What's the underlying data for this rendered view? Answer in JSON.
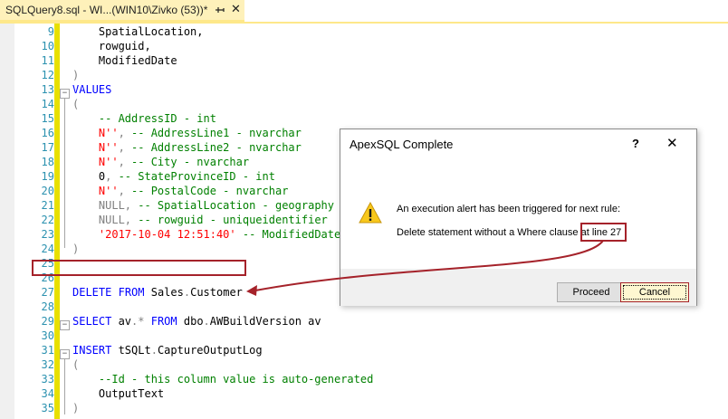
{
  "tab": {
    "title": "SQLQuery8.sql - WI...(WIN10\\Zivko (53))*",
    "close": "✕"
  },
  "editor": {
    "lines": [
      {
        "num": "9",
        "segments": [
          {
            "t": "    SpatialLocation,",
            "c": ""
          }
        ]
      },
      {
        "num": "10",
        "segments": [
          {
            "t": "    rowguid,",
            "c": ""
          }
        ]
      },
      {
        "num": "11",
        "segments": [
          {
            "t": "    ModifiedDate",
            "c": ""
          }
        ]
      },
      {
        "num": "12",
        "segments": [
          {
            "t": ")",
            "c": "gr"
          }
        ]
      },
      {
        "num": "13",
        "segments": [
          {
            "t": "VALUES",
            "c": "kw"
          }
        ]
      },
      {
        "num": "14",
        "segments": [
          {
            "t": "(",
            "c": "gr"
          }
        ]
      },
      {
        "num": "15",
        "segments": [
          {
            "t": "    -- AddressID - int",
            "c": "cm"
          }
        ]
      },
      {
        "num": "16",
        "segments": [
          {
            "t": "    N''",
            "c": "str"
          },
          {
            "t": ", ",
            "c": "gr"
          },
          {
            "t": "-- AddressLine1 - nvarchar",
            "c": "cm"
          }
        ]
      },
      {
        "num": "17",
        "segments": [
          {
            "t": "    N''",
            "c": "str"
          },
          {
            "t": ", ",
            "c": "gr"
          },
          {
            "t": "-- AddressLine2 - nvarchar",
            "c": "cm"
          }
        ]
      },
      {
        "num": "18",
        "segments": [
          {
            "t": "    N''",
            "c": "str"
          },
          {
            "t": ", ",
            "c": "gr"
          },
          {
            "t": "-- City - nvarchar",
            "c": "cm"
          }
        ]
      },
      {
        "num": "19",
        "segments": [
          {
            "t": "    0",
            "c": ""
          },
          {
            "t": ", ",
            "c": "gr"
          },
          {
            "t": "-- StateProvinceID - int",
            "c": "cm"
          }
        ]
      },
      {
        "num": "20",
        "segments": [
          {
            "t": "    N''",
            "c": "str"
          },
          {
            "t": ", ",
            "c": "gr"
          },
          {
            "t": "-- PostalCode - nvarchar",
            "c": "cm"
          }
        ]
      },
      {
        "num": "21",
        "segments": [
          {
            "t": "    NULL",
            "c": "gr"
          },
          {
            "t": ", ",
            "c": "gr"
          },
          {
            "t": "-- SpatialLocation - geography",
            "c": "cm"
          }
        ]
      },
      {
        "num": "22",
        "segments": [
          {
            "t": "    NULL",
            "c": "gr"
          },
          {
            "t": ", ",
            "c": "gr"
          },
          {
            "t": "-- rowguid - uniqueidentifier",
            "c": "cm"
          }
        ]
      },
      {
        "num": "23",
        "segments": [
          {
            "t": "    '2017-10-04 12:51:40'",
            "c": "str"
          },
          {
            "t": " ",
            "c": ""
          },
          {
            "t": "-- ModifiedDate -",
            "c": "cm"
          }
        ]
      },
      {
        "num": "24",
        "segments": [
          {
            "t": ")",
            "c": "gr"
          }
        ]
      },
      {
        "num": "25",
        "segments": [
          {
            "t": "",
            "c": ""
          }
        ]
      },
      {
        "num": "26",
        "segments": [
          {
            "t": "",
            "c": ""
          }
        ]
      },
      {
        "num": "27",
        "segments": [
          {
            "t": "DELETE",
            "c": "kw"
          },
          {
            "t": " ",
            "c": ""
          },
          {
            "t": "FROM",
            "c": "kw"
          },
          {
            "t": " Sales",
            "c": ""
          },
          {
            "t": ".",
            "c": "gr"
          },
          {
            "t": "Customer",
            "c": ""
          }
        ]
      },
      {
        "num": "28",
        "segments": [
          {
            "t": "",
            "c": ""
          }
        ]
      },
      {
        "num": "29",
        "segments": [
          {
            "t": "SELECT",
            "c": "kw"
          },
          {
            "t": " av",
            "c": ""
          },
          {
            "t": ".*",
            "c": "gr"
          },
          {
            "t": " ",
            "c": ""
          },
          {
            "t": "FROM",
            "c": "kw"
          },
          {
            "t": " dbo",
            "c": ""
          },
          {
            "t": ".",
            "c": "gr"
          },
          {
            "t": "AWBuildVersion av",
            "c": ""
          }
        ]
      },
      {
        "num": "30",
        "segments": [
          {
            "t": "",
            "c": ""
          }
        ]
      },
      {
        "num": "31",
        "segments": [
          {
            "t": "INSERT",
            "c": "kw"
          },
          {
            "t": " tSQLt",
            "c": ""
          },
          {
            "t": ".",
            "c": "gr"
          },
          {
            "t": "CaptureOutputLog",
            "c": ""
          }
        ]
      },
      {
        "num": "32",
        "segments": [
          {
            "t": "(",
            "c": "gr"
          }
        ]
      },
      {
        "num": "33",
        "segments": [
          {
            "t": "    --Id - this column value is auto-generated",
            "c": "cm"
          }
        ]
      },
      {
        "num": "34",
        "segments": [
          {
            "t": "    OutputText",
            "c": ""
          }
        ]
      },
      {
        "num": "35",
        "segments": [
          {
            "t": ")",
            "c": "gr"
          }
        ]
      }
    ]
  },
  "dialog": {
    "title": "ApexSQL Complete",
    "help": "?",
    "close": "✕",
    "message1": "An execution alert has been triggered for next rule:",
    "message2": "Delete statement without a Where clause at line 27",
    "proceed_label": "Proceed",
    "cancel_label": "Cancel"
  },
  "icons": {
    "warning": "warning-icon",
    "pin": "pin-icon",
    "close": "close-icon"
  },
  "colors": {
    "keyword": "#0000ff",
    "comment": "#008000",
    "string": "#ff0000",
    "highlight": "#a5222a",
    "tab_active": "#fef1ba"
  }
}
